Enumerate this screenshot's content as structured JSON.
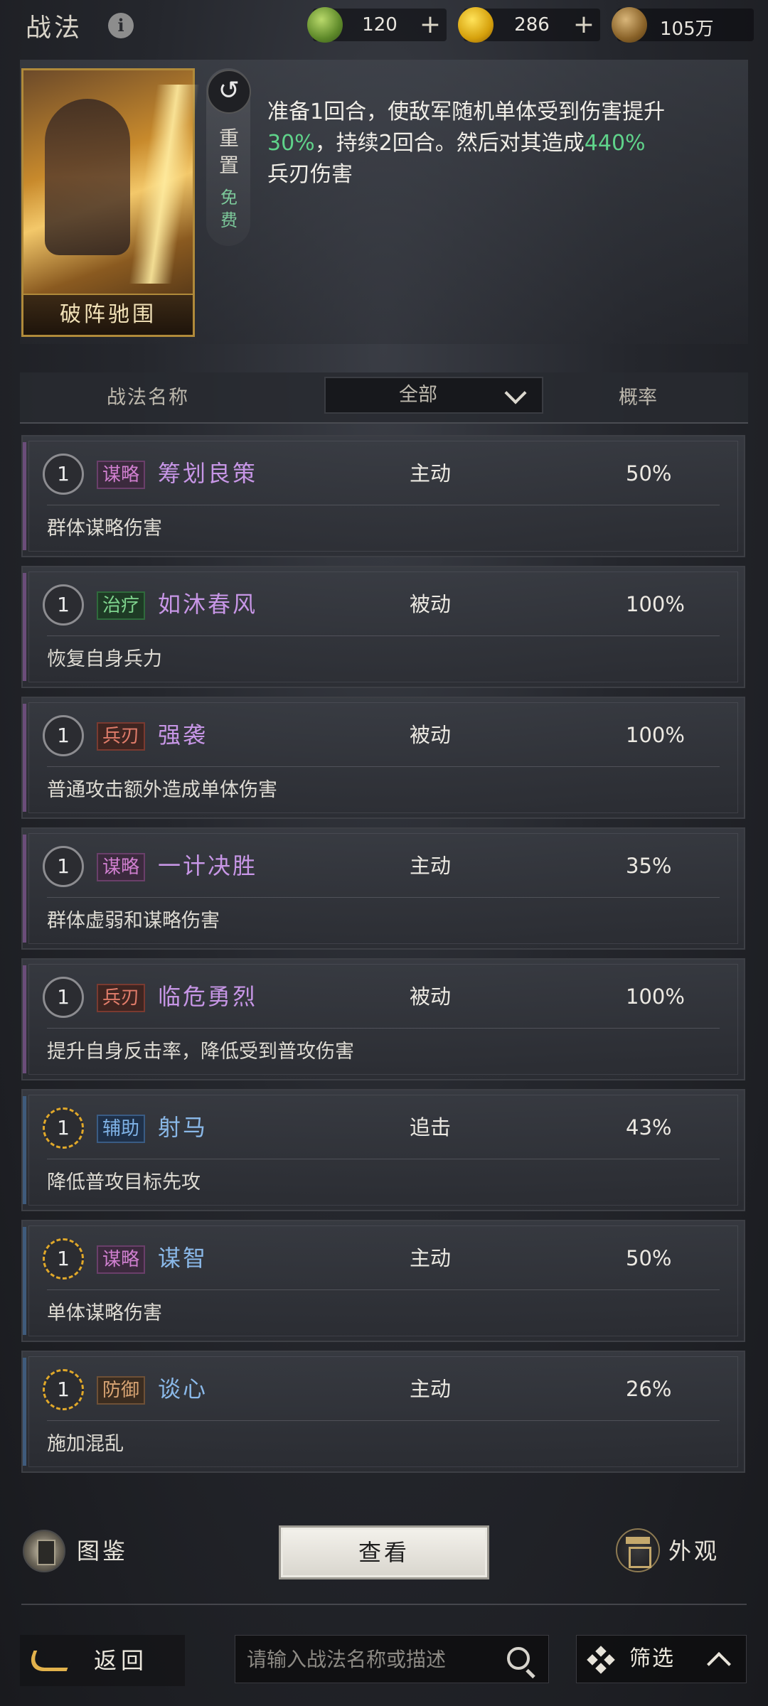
{
  "header": {
    "title": "战法",
    "currencies": [
      {
        "icon": "jade-coin-icon",
        "value": "120",
        "plus": "+"
      },
      {
        "icon": "gold-coin-icon",
        "value": "286",
        "plus": "+"
      },
      {
        "icon": "copper-coin-icon",
        "value": "105万"
      }
    ]
  },
  "detail": {
    "card_name": "破阵驰围",
    "reset_label": "重置",
    "free_label": "免费",
    "description": {
      "p1": "准备1回合，使敌军随机单体受到伤害提升",
      "h1": "30%",
      "p2": "，持续2回合。然后对其造成",
      "h2": "440%",
      "p3": "兵刃伤害"
    }
  },
  "table": {
    "col_name": "战法名称",
    "filter_value": "全部",
    "col_rate": "概率"
  },
  "rows": [
    {
      "level": "1",
      "tag": "谋略",
      "name": "筹划良策",
      "type": "主动",
      "rate": "50%",
      "note": "群体谋略伤害"
    },
    {
      "level": "1",
      "tag": "治疗",
      "name": "如沐春风",
      "type": "被动",
      "rate": "100%",
      "note": "恢复自身兵力"
    },
    {
      "level": "1",
      "tag": "兵刃",
      "name": "强袭",
      "type": "被动",
      "rate": "100%",
      "note": "普通攻击额外造成单体伤害"
    },
    {
      "level": "1",
      "tag": "谋略",
      "name": "一计决胜",
      "type": "主动",
      "rate": "35%",
      "note": "群体虚弱和谋略伤害"
    },
    {
      "level": "1",
      "tag": "兵刃",
      "name": "临危勇烈",
      "type": "被动",
      "rate": "100%",
      "note": "提升自身反击率，降低受到普攻伤害"
    },
    {
      "level": "1",
      "tag": "辅助",
      "name": "射马",
      "type": "追击",
      "rate": "43%",
      "note": "降低普攻目标先攻"
    },
    {
      "level": "1",
      "tag": "谋略",
      "name": "谋智",
      "type": "主动",
      "rate": "50%",
      "note": "单体谋略伤害"
    },
    {
      "level": "1",
      "tag": "防御",
      "name": "谈心",
      "type": "主动",
      "rate": "26%",
      "note": "施加混乱"
    }
  ],
  "actions": {
    "codex_label": "图鉴",
    "view_label": "查看",
    "appearance_label": "外观"
  },
  "footer": {
    "back_label": "返回",
    "search_placeholder": "请输入战法名称或描述",
    "filter_label": "筛选"
  }
}
